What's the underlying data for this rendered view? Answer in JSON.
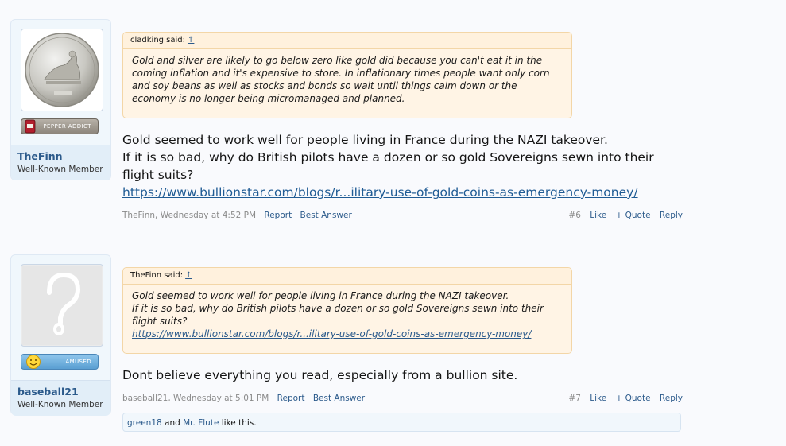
{
  "posts": [
    {
      "user": {
        "name": "TheFinn",
        "title": "Well-Known Member",
        "badge": "PEPPER ADDICT"
      },
      "quote": {
        "author_line": "cladking said:",
        "arrow": "↑",
        "lines": [
          "Gold and silver are likely to go below zero like gold did because you can't eat it in the",
          "coming inflation and it's expensive to store. In inflationary times people want only corn",
          "and soy beans as well as stocks and bonds so wait until things calm down or the",
          "economy is no longer being micromanaged and planned."
        ]
      },
      "message": {
        "line1": "Gold seemed to work well for people living in France during the NAZI takeover.",
        "line2": "If it is so bad, why do British pilots have a dozen or so gold Sovereigns sewn into their",
        "line3": "flight suits?",
        "link": "https://www.bullionstar.com/blogs/r...ilitary-use-of-gold-coins-as-emergency-money/"
      },
      "meta": {
        "author_date": "TheFinn, Wednesday at 4:52 PM",
        "report": "Report",
        "best_answer": "Best Answer",
        "number": "#6",
        "like": "Like",
        "quote": "+ Quote",
        "reply": "Reply"
      }
    },
    {
      "user": {
        "name": "baseball21",
        "title": "Well-Known Member",
        "badge": "AMUSED"
      },
      "quote": {
        "author_line": "TheFinn said:",
        "arrow": "↑",
        "lines": [
          "Gold seemed to work well for people living in France during the NAZI takeover.",
          "If it is so bad, why do British pilots have a dozen or so gold Sovereigns sewn into their",
          "flight suits?"
        ],
        "link": "https://www.bullionstar.com/blogs/r...ilitary-use-of-gold-coins-as-emergency-money/"
      },
      "message": {
        "line1": "Dont believe everything you read, especially from a bullion site."
      },
      "meta": {
        "author_date": "baseball21, Wednesday at 5:01 PM",
        "report": "Report",
        "best_answer": "Best Answer",
        "number": "#7",
        "like": "Like",
        "quote": "+ Quote",
        "reply": "Reply"
      },
      "likes": {
        "user1": "green18",
        "and": " and ",
        "user2": "Mr. Flute",
        "suffix": " like this."
      }
    }
  ],
  "colors": {
    "link": "#2b5a8b",
    "quote_bg": "#fff4e5",
    "panel_bg": "#f0f7fc"
  },
  "icons": {
    "avatar1": "silver-coin-avatar",
    "avatar2": "question-mark-avatar",
    "badge1": "pepper-can-icon",
    "badge2": "smiley-icon"
  }
}
